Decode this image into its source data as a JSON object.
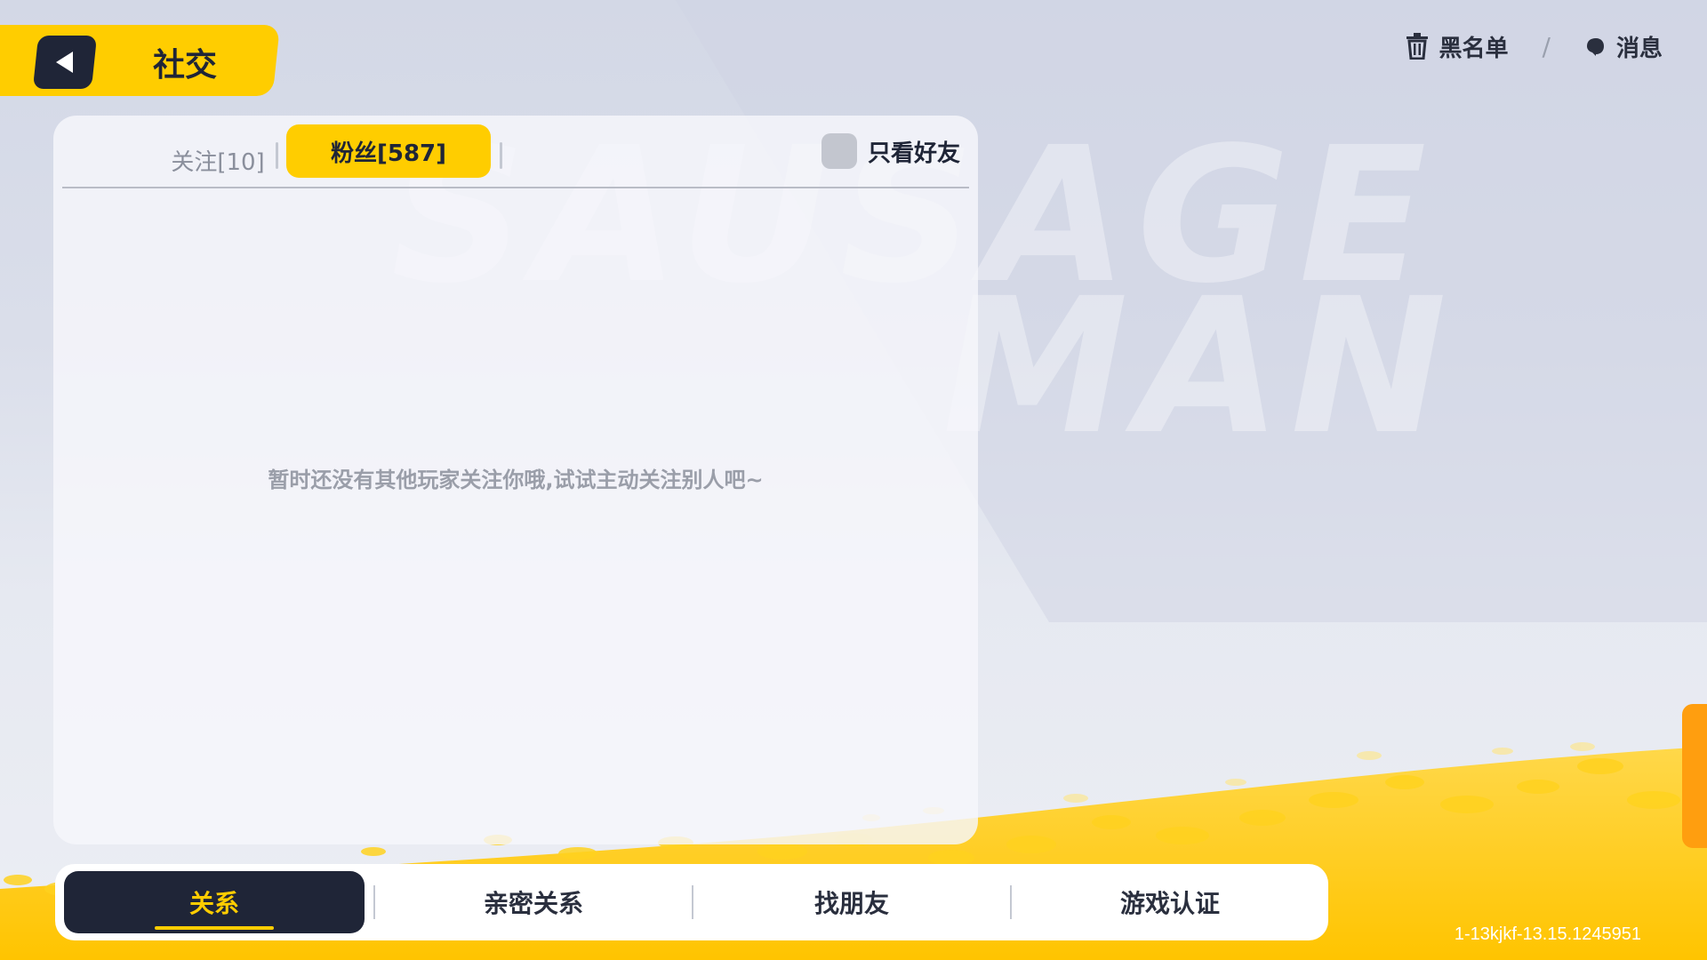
{
  "header": {
    "title": "社交",
    "blacklist_label": "黑名单",
    "messages_label": "消息"
  },
  "background": {
    "watermark_line1": "SAUSAGE",
    "watermark_line2": "MAN"
  },
  "panel": {
    "tabs": [
      {
        "label": "关注[10]",
        "active": false
      },
      {
        "label": "粉丝[587]",
        "active": true
      }
    ],
    "friends_only_label": "只看好友",
    "friends_only_checked": false,
    "empty_message": "暂时还没有其他玩家关注你哦,试试主动关注别人吧~"
  },
  "bottom_nav": {
    "items": [
      {
        "label": "关系",
        "active": true
      },
      {
        "label": "亲密关系",
        "active": false
      },
      {
        "label": "找朋友",
        "active": false
      },
      {
        "label": "游戏认证",
        "active": false
      }
    ]
  },
  "version": "1-13kjkf-13.15.1245951",
  "colors": {
    "accent_yellow": "#ffcd00",
    "dark_navy": "#1f2537",
    "side_handle_orange": "#ff9e0f"
  }
}
